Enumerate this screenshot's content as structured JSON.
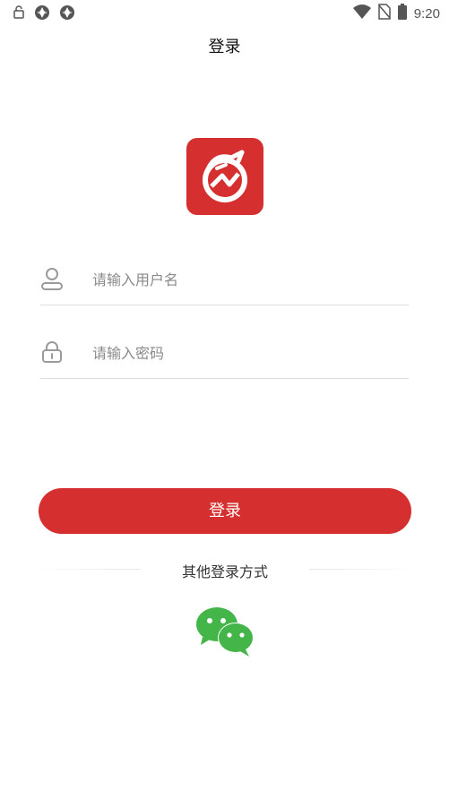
{
  "status_bar": {
    "time": "9:20",
    "left_icons": [
      "lock-icon",
      "sync-icon",
      "sync-icon"
    ],
    "right_icons": [
      "wifi-icon",
      "no-sim-icon",
      "battery-icon"
    ]
  },
  "header": {
    "title": "登录"
  },
  "logo": {
    "icon": "dragon-logo-icon",
    "color": "#d62f2f"
  },
  "form": {
    "username": {
      "placeholder": "请输入用户名",
      "value": "",
      "icon": "user-icon"
    },
    "password": {
      "placeholder": "请输入密码",
      "value": "",
      "icon": "lock-icon"
    }
  },
  "login_button": {
    "label": "登录",
    "color": "#d62f2f"
  },
  "other_login": {
    "label": "其他登录方式",
    "options": [
      {
        "icon": "wechat-icon",
        "color": "#44b549"
      }
    ]
  }
}
